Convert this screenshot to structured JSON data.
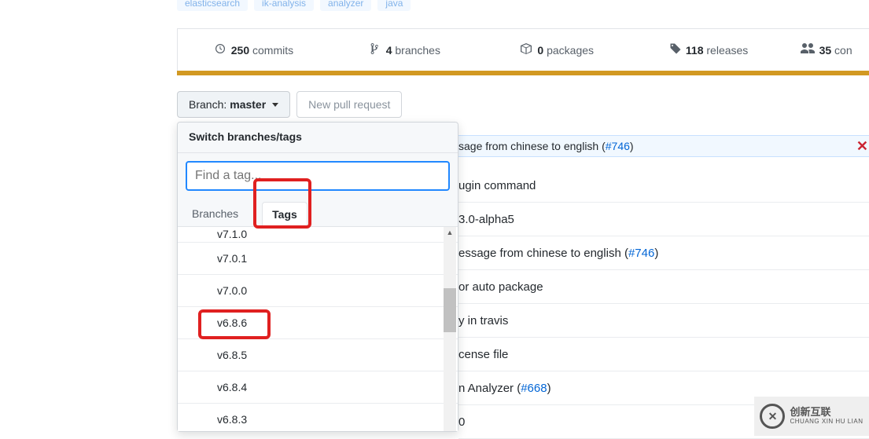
{
  "topics": [
    "elasticsearch",
    "ik-analysis",
    "analyzer",
    "java"
  ],
  "stats": {
    "commits_count": "250",
    "commits_label": "commits",
    "branches_count": "4",
    "branches_label": "branches",
    "packages_count": "0",
    "packages_label": "packages",
    "releases_count": "118",
    "releases_label": "releases",
    "contributors_count": "35",
    "contributors_label": "con"
  },
  "branch_button": {
    "prefix": "Branch:",
    "value": "master"
  },
  "new_pr": "New pull request",
  "commit_banner": {
    "text_prefix": "sage from chinese to english (",
    "link": "#746",
    "text_suffix": ")"
  },
  "file_rows": [
    "ugin command",
    "3.0-alpha5",
    {
      "pre": "essage from chinese to english (",
      "link": "#746",
      "post": ")"
    },
    "or auto package",
    "y in travis",
    "cense file",
    {
      "pre": "n Analyzer (",
      "link": "#668",
      "post": ")"
    },
    "0"
  ],
  "dropdown": {
    "title": "Switch branches/tags",
    "placeholder": "Find a tag...",
    "tabs": {
      "branches": "Branches",
      "tags": "Tags"
    },
    "items": [
      "v7.1.0",
      "v7.0.1",
      "v7.0.0",
      "v6.8.6",
      "v6.8.5",
      "v6.8.4",
      "v6.8.3"
    ]
  },
  "logo": {
    "primary": "创新互联",
    "secondary": "CHUANG XIN HU LIAN"
  }
}
